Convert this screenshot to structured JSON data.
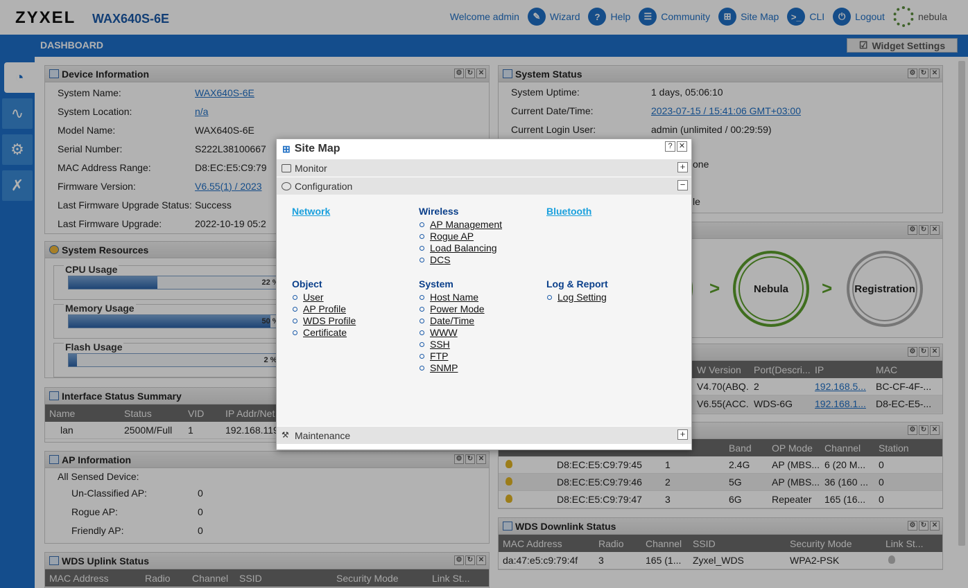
{
  "header": {
    "logo": "ZYXEL",
    "model": "WAX640S-6E",
    "nav": [
      {
        "label": "Welcome admin"
      },
      {
        "label": "Wizard"
      },
      {
        "label": "Help"
      },
      {
        "label": "Community"
      },
      {
        "label": "Site Map"
      },
      {
        "label": "CLI"
      },
      {
        "label": "Logout"
      },
      {
        "label": "nebula"
      }
    ]
  },
  "bar": {
    "title": "DASHBOARD",
    "widget_settings": "Widget Settings"
  },
  "device_info": {
    "title": "Device Information",
    "rows": [
      {
        "k": "System Name:",
        "v": "WAX640S-6E"
      },
      {
        "k": "System Location:",
        "v": "n/a"
      },
      {
        "k": "Model Name:",
        "v": "WAX640S-6E"
      },
      {
        "k": "Serial Number:",
        "v": "S222L38100667"
      },
      {
        "k": "MAC Address Range:",
        "v": "D8:EC:E5:C9:79"
      },
      {
        "k": "Firmware Version:",
        "v": "V6.55(1) / 2023"
      },
      {
        "k": "Last Firmware Upgrade Status:",
        "v": "Success"
      },
      {
        "k": "Last Firmware Upgrade:",
        "v": "2022-10-19 05:2"
      }
    ]
  },
  "system_status": {
    "title": "System Status",
    "rows": [
      {
        "k": "System Uptime:",
        "v": "1 days, 05:06:10"
      },
      {
        "k": "Current Date/Time:",
        "v": "2023-07-15 / 15:41:06 GMT+03:00"
      },
      {
        "k": "Current Login User:",
        "v": "admin (unlimited / 00:29:59)"
      }
    ],
    "partial1": "one",
    "partial2": "le"
  },
  "resources": {
    "title": "System Resources",
    "cpu": {
      "label": "CPU Usage",
      "pct": 22,
      "text": "22 %"
    },
    "mem": {
      "label": "Memory Usage",
      "pct": 50,
      "text": "50 %"
    },
    "flash": {
      "label": "Flash Usage",
      "pct": 2,
      "text": "2 %"
    }
  },
  "iface": {
    "title": "Interface Status Summary",
    "headers": [
      "Name",
      "Status",
      "VID",
      "IP Addr/Net"
    ],
    "row": [
      "lan",
      "2500M/Full",
      "1",
      "192.168.119"
    ]
  },
  "ap_info": {
    "title": "AP Information",
    "link": "All Sensed Device",
    "rows": [
      {
        "k": "Un-Classified AP:",
        "v": "0"
      },
      {
        "k": "Rogue AP:",
        "v": "0"
      },
      {
        "k": "Friendly AP:",
        "v": "0"
      }
    ]
  },
  "wds_uplink": {
    "title": "WDS Uplink Status",
    "headers": [
      "MAC Address",
      "Radio",
      "Channel",
      "SSID",
      "Security Mode",
      "Link St..."
    ]
  },
  "registration": {
    "nebula": "Nebula",
    "registration": "Registration"
  },
  "uplink_table": {
    "headers": [
      "W Version",
      "Port(Descri...",
      "IP",
      "MAC"
    ],
    "rows": [
      [
        "V4.70(ABQ...",
        "2",
        "192.168.5...",
        "BC-CF-4F-..."
      ],
      [
        "V6.55(ACC...",
        "WDS-6G",
        "192.168.1...",
        "D8-EC-E5-..."
      ]
    ]
  },
  "radio_table": {
    "headers": [
      "Band",
      "OP Mode",
      "Channel",
      "Station"
    ],
    "rows": [
      [
        "D8:EC:E5:C9:79:45",
        "1",
        "2.4G",
        "AP (MBS...",
        "6 (20 M...",
        "0"
      ],
      [
        "D8:EC:E5:C9:79:46",
        "2",
        "5G",
        "AP (MBS...",
        "36 (160 ...",
        "0"
      ],
      [
        "D8:EC:E5:C9:79:47",
        "3",
        "6G",
        "Repeater",
        "165 (16...",
        "0"
      ]
    ]
  },
  "wds_downlink": {
    "title": "WDS Downlink Status",
    "headers": [
      "MAC Address",
      "Radio",
      "Channel",
      "SSID",
      "Security Mode",
      "Link St..."
    ],
    "row": [
      "da:47:e5:c9:79:4f",
      "3",
      "165 (1...",
      "Zyxel_WDS",
      "WPA2-PSK"
    ]
  },
  "sitemap": {
    "title": "Site Map",
    "monitor": "Monitor",
    "configuration": "Configuration",
    "maintenance": "Maintenance",
    "network": "Network",
    "wireless": {
      "head": "Wireless",
      "items": [
        "AP Management",
        "Rogue AP",
        "Load Balancing",
        "DCS"
      ]
    },
    "bluetooth": "Bluetooth",
    "object": {
      "head": "Object",
      "items": [
        "User",
        "AP Profile",
        "WDS Profile",
        "Certificate"
      ]
    },
    "system": {
      "head": "System",
      "items": [
        "Host Name",
        "Power Mode",
        "Date/Time",
        "WWW",
        "SSH",
        "FTP",
        "SNMP"
      ]
    },
    "log": {
      "head": "Log & Report",
      "items": [
        "Log Setting"
      ]
    }
  }
}
